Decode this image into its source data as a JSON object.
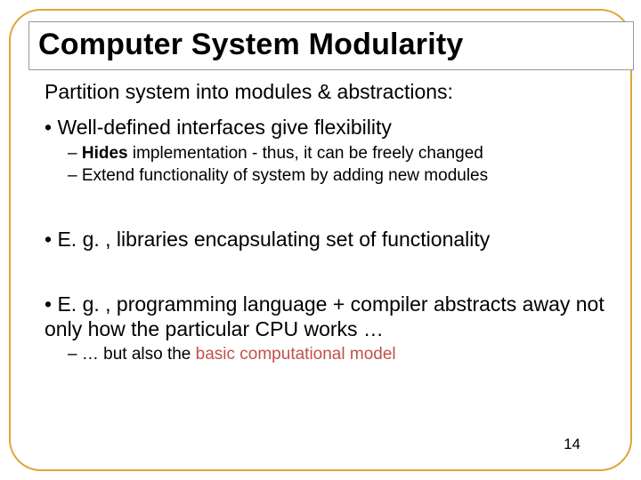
{
  "title": "Computer System Modularity",
  "subtitle": "Partition system into modules & abstractions:",
  "bullets": {
    "b1": "Well-defined interfaces give flexibility",
    "b1_sub1_strong": "Hides",
    "b1_sub1_rest": " implementation - thus, it can be freely changed",
    "b1_sub2": "Extend functionality of system by adding new modules",
    "b2": "E. g. , libraries encapsulating set of functionality",
    "b3": "E. g. , programming language + compiler abstracts away not only how the particular CPU works …",
    "b3_sub1_pre": "… but also the ",
    "b3_sub1_accent": "basic computational model"
  },
  "page_number": "14"
}
